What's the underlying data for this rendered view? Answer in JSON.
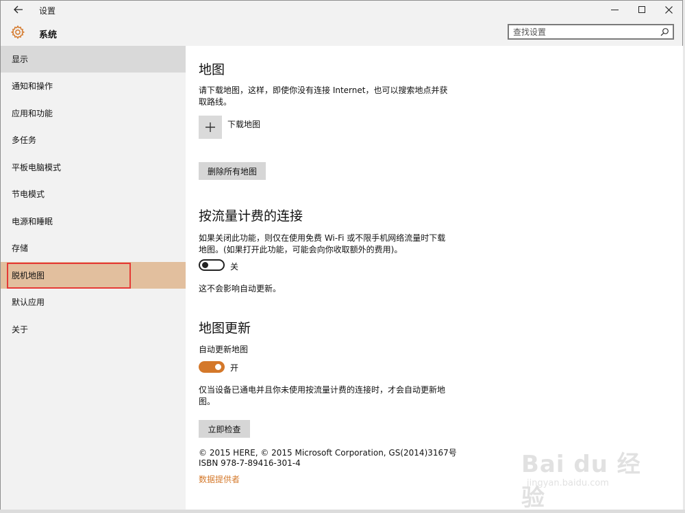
{
  "window": {
    "title": "设置",
    "back_icon": "arrow-left-icon",
    "colors": {
      "accent": "#d4782a",
      "selected_bg": "#e2bf9e",
      "hover_bg": "#d9d9d9",
      "sidebar_bg": "#f2f2f2"
    }
  },
  "header": {
    "icon": "gear-icon",
    "title": "系统",
    "search_placeholder": "查找设置"
  },
  "sidebar": {
    "items": [
      {
        "label": "显示",
        "state": "hover"
      },
      {
        "label": "通知和操作",
        "state": ""
      },
      {
        "label": "应用和功能",
        "state": ""
      },
      {
        "label": "多任务",
        "state": ""
      },
      {
        "label": "平板电脑模式",
        "state": ""
      },
      {
        "label": "节电模式",
        "state": ""
      },
      {
        "label": "电源和睡眠",
        "state": ""
      },
      {
        "label": "存储",
        "state": ""
      },
      {
        "label": "脱机地图",
        "state": "selected"
      },
      {
        "label": "默认应用",
        "state": ""
      },
      {
        "label": "关于",
        "state": ""
      }
    ]
  },
  "main": {
    "maps": {
      "heading": "地图",
      "description": "请下载地图，这样，即使你没有连接 Internet，也可以搜索地点并获取路线。",
      "download_label": "下载地图",
      "delete_all_label": "删除所有地图"
    },
    "metered": {
      "heading": "按流量计费的连接",
      "description": "如果关闭此功能，则仅在使用免费 Wi-Fi 或不限手机网络流量时下载地图。(如果打开此功能，可能会向你收取额外的费用)。",
      "toggle_on": false,
      "toggle_label": "关",
      "note": "这不会影响自动更新。"
    },
    "updates": {
      "heading": "地图更新",
      "auto_label": "自动更新地图",
      "toggle_on": true,
      "toggle_label": "开",
      "description": "仅当设备已通电并且你未使用按流量计费的连接时，才会自动更新地图。",
      "check_now_label": "立即检查"
    },
    "copyright_line1": "© 2015 HERE, © 2015 Microsoft Corporation, GS(2014)3167号",
    "copyright_line2": "ISBN 978-7-89416-301-4",
    "provider_link": "数据提供者"
  },
  "watermark": {
    "main": "Bai du 经验",
    "sub": "jingyan.baidu.com"
  }
}
